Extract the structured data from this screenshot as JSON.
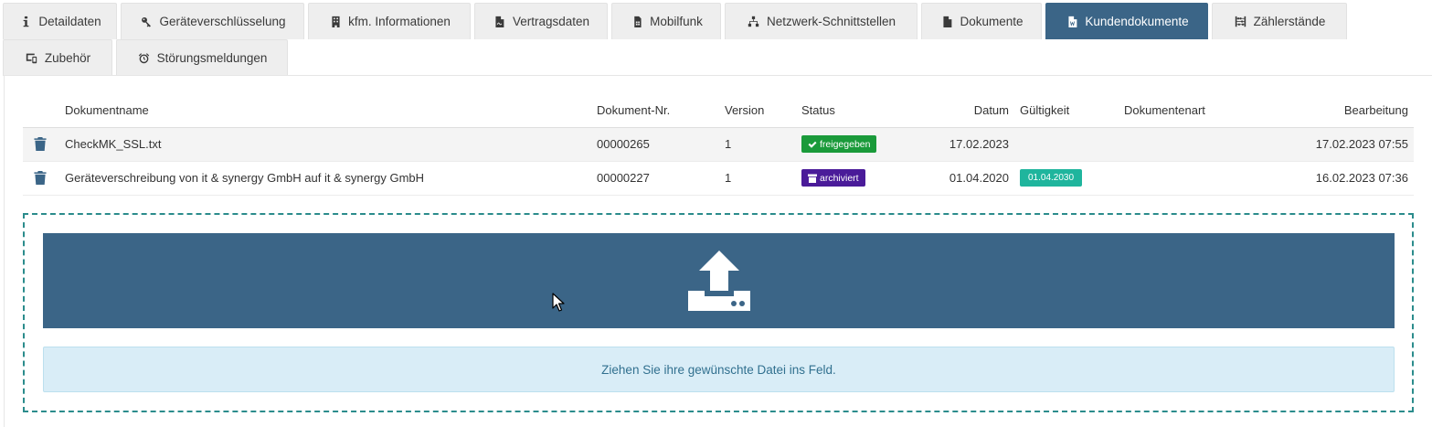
{
  "tabs": [
    {
      "label": "Detaildaten",
      "icon": "info-icon"
    },
    {
      "label": "Geräteverschlüsselung",
      "icon": "key-icon"
    },
    {
      "label": "kfm. Informationen",
      "icon": "building-icon"
    },
    {
      "label": "Vertragsdaten",
      "icon": "contract-file-icon"
    },
    {
      "label": "Mobilfunk",
      "icon": "sim-card-icon"
    },
    {
      "label": "Netzwerk-Schnittstellen",
      "icon": "network-icon"
    },
    {
      "label": "Dokumente",
      "icon": "file-icon"
    },
    {
      "label": "Kundendokumente",
      "icon": "word-file-icon",
      "active": true
    },
    {
      "label": "Zählerstände",
      "icon": "abacus-icon"
    },
    {
      "label": "Zubehör",
      "icon": "devices-icon"
    },
    {
      "label": "Störungsmeldungen",
      "icon": "alarm-clock-icon"
    }
  ],
  "table": {
    "headers": {
      "name": "Dokumentname",
      "number": "Dokument-Nr.",
      "version": "Version",
      "status": "Status",
      "date": "Datum",
      "validity": "Gültigkeit",
      "type": "Dokumentenart",
      "edited": "Bearbeitung"
    },
    "rows": [
      {
        "name": "CheckMK_SSL.txt",
        "number": "00000265",
        "version": "1",
        "status": "freigegeben",
        "status_color": "#1a9a3a",
        "date": "17.02.2023",
        "validity": "",
        "type": "",
        "edited": "17.02.2023 07:55"
      },
      {
        "name": "Geräteverschreibung von it & synergy GmbH auf it & synergy GmbH",
        "number": "00000227",
        "version": "1",
        "status": "archiviert",
        "status_color": "#4a1b99",
        "date": "01.04.2020",
        "validity": "01.04.2030",
        "type": "",
        "edited": "16.02.2023 07:36"
      }
    ]
  },
  "upload": {
    "icon": "upload-icon",
    "hint": "Ziehen Sie ihre gewünschte Datei ins Feld."
  },
  "colors": {
    "accent": "#3b6587",
    "dropzone_border": "#2b8c8c",
    "hint_bg": "#d9edf7"
  }
}
